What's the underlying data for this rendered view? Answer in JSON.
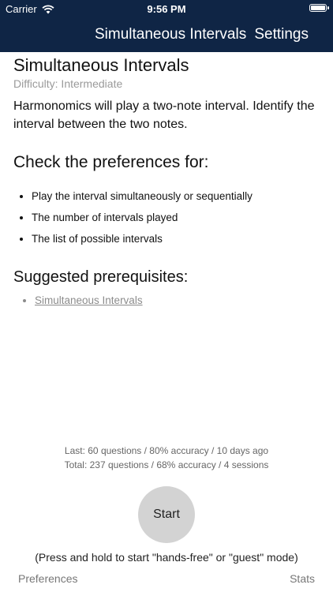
{
  "status_bar": {
    "carrier": "Carrier",
    "time": "9:56 PM",
    "battery_level": 1.0
  },
  "nav": {
    "title": "Simultaneous Intervals",
    "settings_label": "Settings"
  },
  "exercise": {
    "title": "Simultaneous Intervals",
    "difficulty": "Difficulty: Intermediate",
    "description": "Harmonomics will play a two-note interval. Identify the interval between the two notes."
  },
  "preferences_section": {
    "heading": "Check the preferences for:",
    "items": [
      "Play the interval simultaneously or sequentially",
      "The number of intervals played",
      "The list of possible intervals"
    ]
  },
  "prerequisites_section": {
    "heading": "Suggested prerequisites:",
    "items": [
      "Simultaneous Intervals"
    ]
  },
  "stats": {
    "last": "Last: 60 questions / 80% accuracy / 10 days ago",
    "total": "Total: 237 questions / 68% accuracy / 4 sessions"
  },
  "start_label": "Start",
  "hint": "(Press and hold to start \"hands-free\" or \"guest\" mode)",
  "footer": {
    "preferences_label": "Preferences",
    "stats_label": "Stats"
  },
  "colors": {
    "nav_background": "#0f2545",
    "start_button": "#d3d3d3"
  },
  "icons": [
    "wifi-icon",
    "battery-icon"
  ]
}
